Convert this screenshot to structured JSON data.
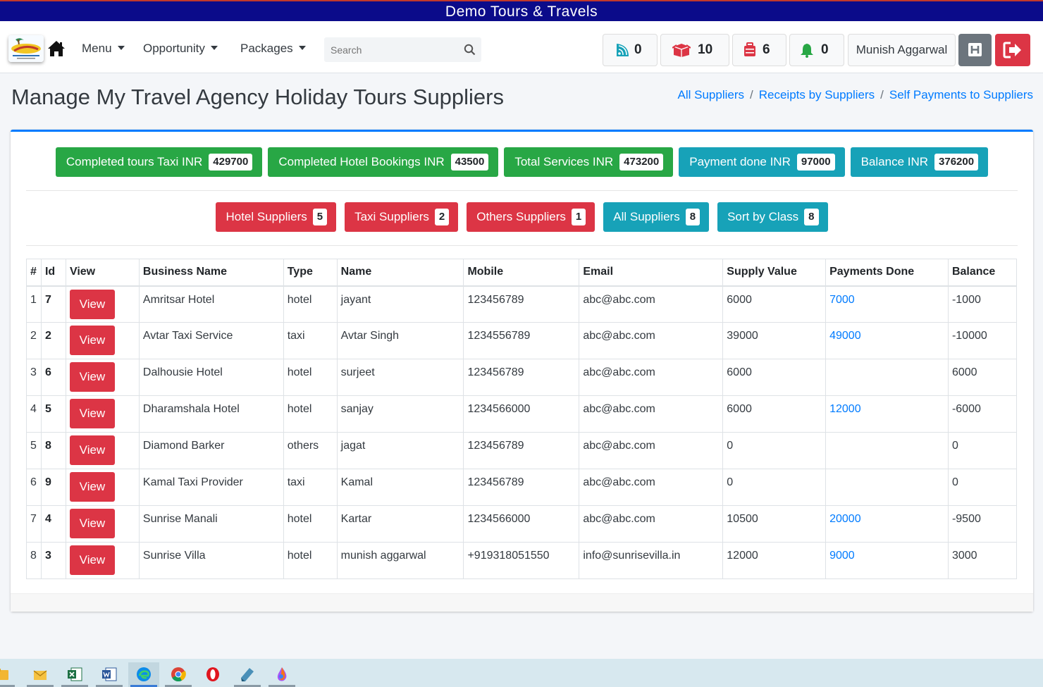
{
  "banner": {
    "title": "Demo Tours & Travels"
  },
  "nav": {
    "menu_label": "Menu",
    "opportunity_label": "Opportunity",
    "packages_label": "Packages",
    "search_placeholder": "Search",
    "counters": [
      {
        "icon": "feed-icon",
        "value": "0",
        "color": "#17a2b8"
      },
      {
        "icon": "box-icon",
        "value": "10",
        "color": "#dc3545"
      },
      {
        "icon": "luggage-icon",
        "value": "6",
        "color": "#dc3545"
      },
      {
        "icon": "bell-icon",
        "value": "0",
        "color": "#28a745"
      }
    ],
    "user_name": "Munish Aggarwal",
    "h_button_label": "H"
  },
  "page": {
    "title": "Manage My Travel Agency Holiday Tours Suppliers",
    "breadcrumb": [
      "All Suppliers",
      "Receipts by Suppliers",
      "Self Payments to Suppliers"
    ]
  },
  "stats": [
    {
      "label": "Completed tours Taxi INR",
      "value": "429700",
      "color": "green"
    },
    {
      "label": "Completed Hotel Bookings INR",
      "value": "43500",
      "color": "green"
    },
    {
      "label": "Total Services INR",
      "value": "473200",
      "color": "green"
    },
    {
      "label": "Payment done INR",
      "value": "97000",
      "color": "teal"
    },
    {
      "label": "Balance INR",
      "value": "376200",
      "color": "teal"
    }
  ],
  "filters": [
    {
      "label": "Hotel Suppliers",
      "count": "5",
      "color": "red"
    },
    {
      "label": "Taxi Suppliers",
      "count": "2",
      "color": "red"
    },
    {
      "label": "Others Suppliers",
      "count": "1",
      "color": "red"
    },
    {
      "label": "All Suppliers",
      "count": "8",
      "color": "teal"
    },
    {
      "label": "Sort by Class",
      "count": "8",
      "color": "teal"
    }
  ],
  "table": {
    "headers": [
      "#",
      "Id",
      "View",
      "Business Name",
      "Type",
      "Name",
      "Mobile",
      "Email",
      "Supply Value",
      "Payments Done",
      "Balance"
    ],
    "view_label": "View",
    "rows": [
      {
        "n": "1",
        "id": "7",
        "business": "Amritsar Hotel",
        "type": "hotel",
        "name": "jayant",
        "mobile": "123456789",
        "email": "abc@abc.com",
        "supply": "6000",
        "payments": "7000",
        "balance": "-1000"
      },
      {
        "n": "2",
        "id": "2",
        "business": "Avtar Taxi Service",
        "type": "taxi",
        "name": "Avtar Singh",
        "mobile": "1234556789",
        "email": "abc@abc.com",
        "supply": "39000",
        "payments": "49000",
        "balance": "-10000"
      },
      {
        "n": "3",
        "id": "6",
        "business": "Dalhousie Hotel",
        "type": "hotel",
        "name": "surjeet",
        "mobile": "123456789",
        "email": "abc@abc.com",
        "supply": "6000",
        "payments": "",
        "balance": "6000"
      },
      {
        "n": "4",
        "id": "5",
        "business": "Dharamshala Hotel",
        "type": "hotel",
        "name": "sanjay",
        "mobile": "1234566000",
        "email": "abc@abc.com",
        "supply": "6000",
        "payments": "12000",
        "balance": "-6000"
      },
      {
        "n": "5",
        "id": "8",
        "business": "Diamond Barker",
        "type": "others",
        "name": "jagat",
        "mobile": "123456789",
        "email": "abc@abc.com",
        "supply": "0",
        "payments": "",
        "balance": "0"
      },
      {
        "n": "6",
        "id": "9",
        "business": "Kamal Taxi Provider",
        "type": "taxi",
        "name": "Kamal",
        "mobile": "123456789",
        "email": "abc@abc.com",
        "supply": "0",
        "payments": "",
        "balance": "0"
      },
      {
        "n": "7",
        "id": "4",
        "business": "Sunrise Manali",
        "type": "hotel",
        "name": "Kartar",
        "mobile": "1234566000",
        "email": "abc@abc.com",
        "supply": "10500",
        "payments": "20000",
        "balance": "-9500"
      },
      {
        "n": "8",
        "id": "3",
        "business": "Sunrise Villa",
        "type": "hotel",
        "name": "munish aggarwal",
        "mobile": "+919318051550",
        "email": "info@sunrisevilla.in",
        "supply": "12000",
        "payments": "9000",
        "balance": "3000"
      }
    ]
  },
  "taskbar": {
    "apps": [
      {
        "icon": "file-explorer-icon",
        "color": "#f2b632"
      },
      {
        "icon": "mail-folder-icon",
        "color": "#f5c242"
      },
      {
        "icon": "excel-icon",
        "color": "#1d7044"
      },
      {
        "icon": "word-icon",
        "color": "#2b579a"
      },
      {
        "icon": "edge-icon",
        "color": "#0c8ce9"
      },
      {
        "icon": "chrome-icon",
        "color": "#34a853"
      },
      {
        "icon": "opera-icon",
        "color": "#e0161f"
      },
      {
        "icon": "notes-icon",
        "color": "#4a90b8"
      },
      {
        "icon": "paint-icon",
        "color": "#a855f7"
      }
    ]
  }
}
